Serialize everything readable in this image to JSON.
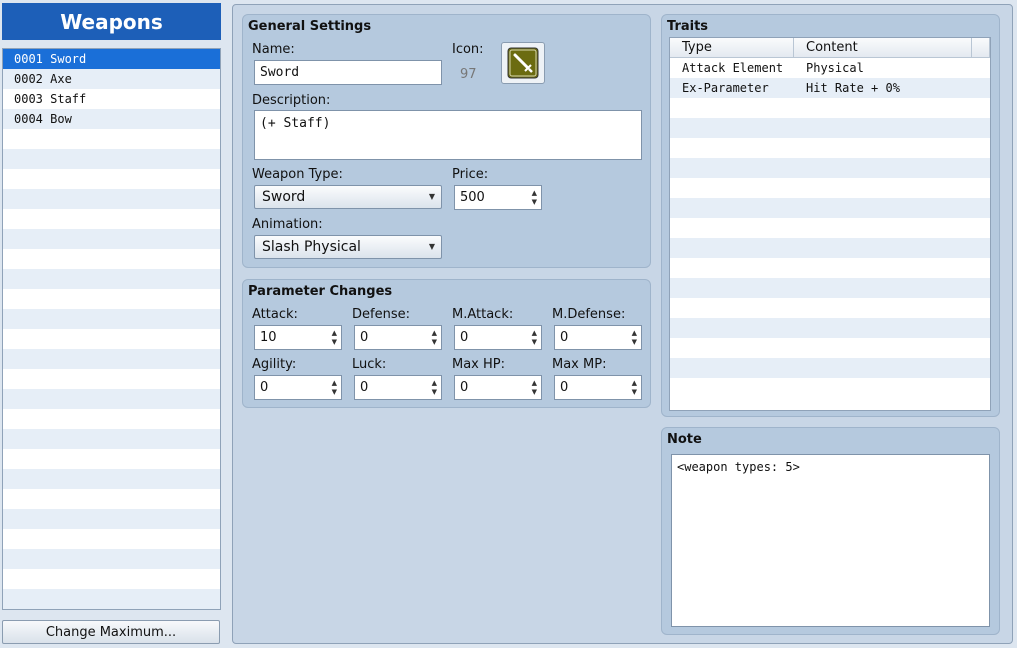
{
  "sidebar": {
    "title": "Weapons",
    "items": [
      {
        "label": "0001 Sword"
      },
      {
        "label": "0002 Axe"
      },
      {
        "label": "0003 Staff"
      },
      {
        "label": "0004 Bow"
      }
    ],
    "selected_index": 0,
    "change_max_label": "Change Maximum..."
  },
  "general": {
    "title": "General Settings",
    "name_label": "Name:",
    "name_value": "Sword",
    "icon_label": "Icon:",
    "icon_index": "97",
    "icon_name": "sword-icon",
    "description_label": "Description:",
    "description_value": "(+ Staff)",
    "weapon_type_label": "Weapon Type:",
    "weapon_type_value": "Sword",
    "price_label": "Price:",
    "price_value": "500",
    "animation_label": "Animation:",
    "animation_value": "Slash Physical"
  },
  "params": {
    "title": "Parameter Changes",
    "fields": [
      {
        "label": "Attack:",
        "value": "10"
      },
      {
        "label": "Defense:",
        "value": "0"
      },
      {
        "label": "M.Attack:",
        "value": "0"
      },
      {
        "label": "M.Defense:",
        "value": "0"
      },
      {
        "label": "Agility:",
        "value": "0"
      },
      {
        "label": "Luck:",
        "value": "0"
      },
      {
        "label": "Max HP:",
        "value": "0"
      },
      {
        "label": "Max MP:",
        "value": "0"
      }
    ]
  },
  "traits": {
    "title": "Traits",
    "columns": [
      "Type",
      "Content"
    ],
    "rows": [
      {
        "type": "Attack Element",
        "content": "Physical"
      },
      {
        "type": "Ex-Parameter",
        "content": "Hit Rate + 0%"
      }
    ]
  },
  "note": {
    "title": "Note",
    "value": "<weapon types: 5>"
  },
  "colors": {
    "header_bg": "#1d5fb8",
    "selected_row": "#1a6fd8",
    "panel_bg": "#c8d6e6",
    "group_bg": "#b5c9de",
    "icon_bg": "#6b6b10"
  }
}
